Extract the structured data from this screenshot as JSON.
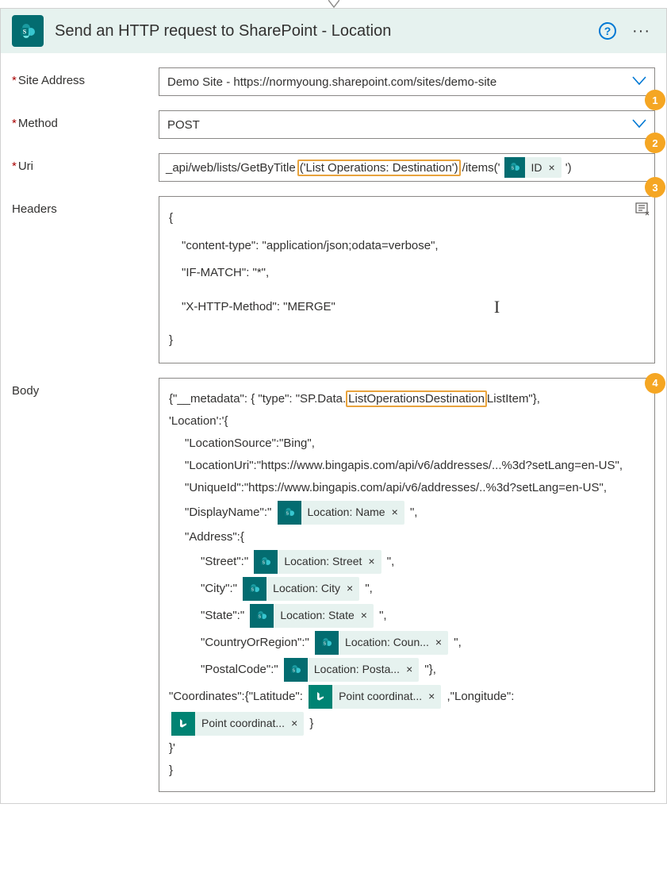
{
  "header": {
    "title": "Send an HTTP request to SharePoint - Location"
  },
  "fields": {
    "site_address_label": "Site Address",
    "site_address_value": "Demo Site - https://normyoung.sharepoint.com/sites/demo-site",
    "method_label": "Method",
    "method_value": "POST",
    "uri_label": "Uri",
    "uri_prefix": "_api/web/lists/GetByTitle",
    "uri_highlight": "('List Operations: Destination')",
    "uri_mid": "/items('",
    "uri_token": "ID",
    "uri_suffix": "')",
    "headers_label": "Headers",
    "headers_lines": {
      "l1": "{",
      "l2": "\"content-type\": \"application/json;odata=verbose\",",
      "l3": "\"IF-MATCH\": \"*\",",
      "l4": "\"X-HTTP-Method\": \"MERGE\"",
      "l5": "}"
    },
    "body_label": "Body"
  },
  "body": {
    "l1a": "{\"__metadata\": { \"type\": \"SP.Data.",
    "l1_hi": "ListOperationsDestination",
    "l1b": "ListItem\"},",
    "l2": "'Location':'{",
    "l3": "\"LocationSource\":\"Bing\",",
    "l4": "\"LocationUri\":\"https://www.bingapis.com/api/v6/addresses/...%3d?setLang=en-US\",",
    "l5": "\"UniqueId\":\"https://www.bingapis.com/api/v6/addresses/..%3d?setLang=en-US\",",
    "l6a": "\"DisplayName\":\"",
    "t_name": "Location: Name",
    "l6b": "\",",
    "l7": "\"Address\":{",
    "l8a": "\"Street\":\"",
    "t_street": "Location: Street",
    "l8b": "\",",
    "l9a": "\"City\":\"",
    "t_city": "Location: City",
    "l9b": "\",",
    "l10a": "\"State\":\"",
    "t_state": "Location: State",
    "l10b": "\",",
    "l11a": "\"CountryOrRegion\":\"",
    "t_country": "Location: Coun...",
    "l11b": "\",",
    "l12a": "\"PostalCode\":\"",
    "t_postal": "Location: Posta...",
    "l12b": "\"},",
    "l13a": "\"Coordinates\":{\"Latitude\":",
    "t_lat": "Point coordinat...",
    "l13b": ",\"Longitude\":",
    "t_lon": "Point coordinat...",
    "l14": "}",
    "l15": "}'",
    "l16": "}"
  },
  "badges": {
    "b1": "1",
    "b2": "2",
    "b3": "3",
    "b4": "4"
  }
}
